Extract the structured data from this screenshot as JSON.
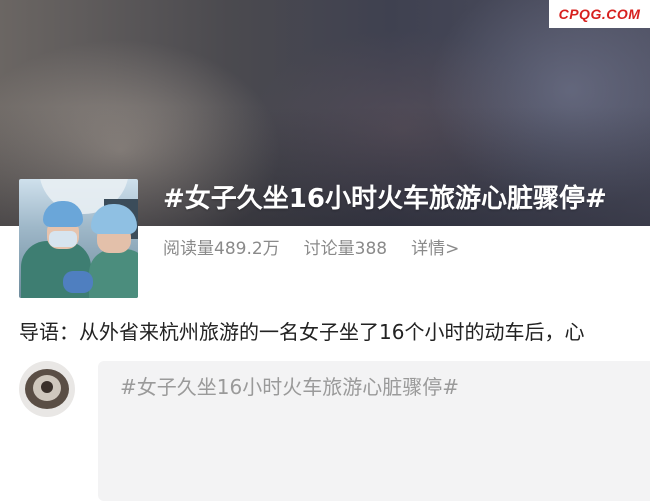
{
  "watermark": "CPQG.COM",
  "topic": {
    "title": "#女子久坐16小时火车旅游心脏骤停#",
    "reads": "阅读量489.2万",
    "discussions": "讨论量388",
    "details_link": "详情>"
  },
  "intro_text": "导语：从外省来杭州旅游的一名女子坐了16个小时的动车后，心",
  "comment": {
    "placeholder": "#女子久坐16小时火车旅游心脏骤停#"
  },
  "colors": {
    "watermark": "#d7201e",
    "meta_text": "#8a8a8a",
    "input_bg": "#f3f3f4"
  }
}
